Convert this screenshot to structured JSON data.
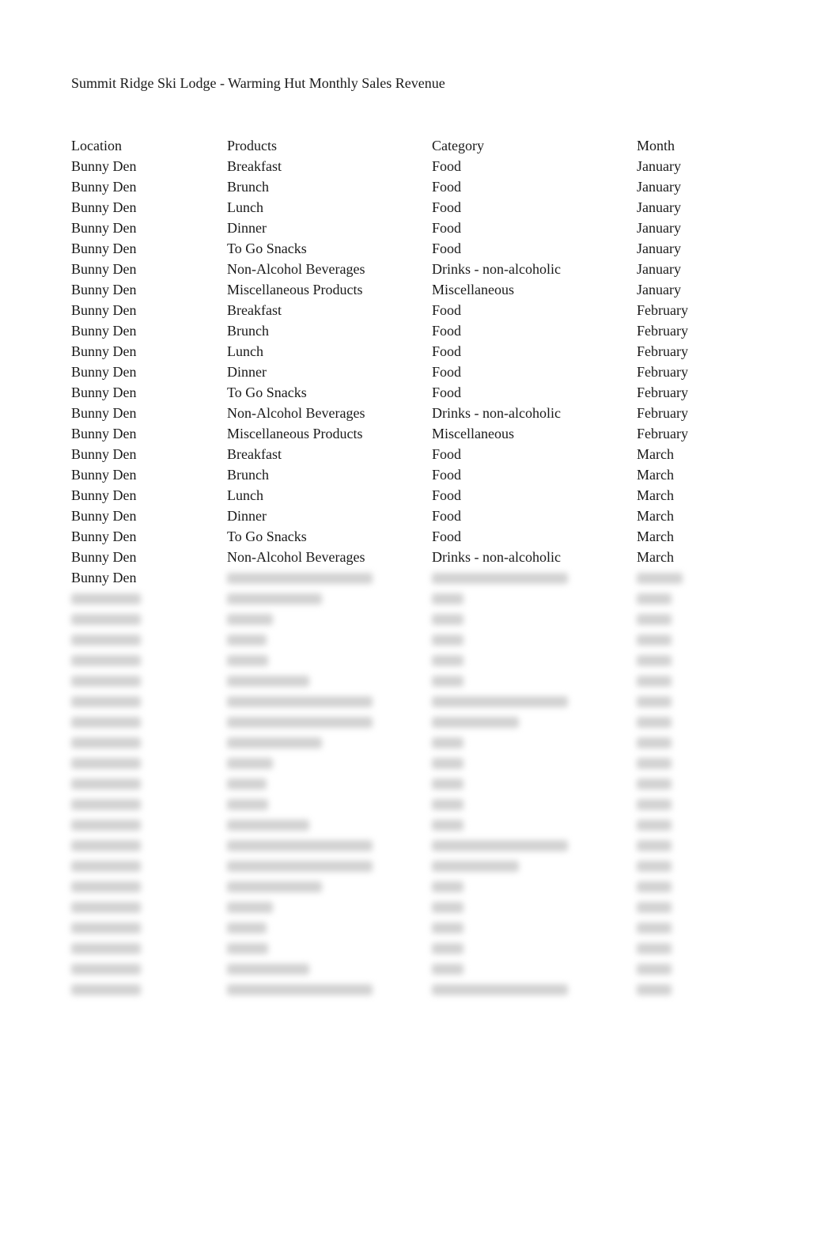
{
  "document": {
    "title": "Summit Ridge Ski Lodge - Warming Hut Monthly Sales Revenue"
  },
  "table": {
    "headers": [
      "Location",
      "Products",
      "Category",
      "Month"
    ],
    "rows": [
      [
        "Bunny Den",
        "Breakfast",
        "Food",
        "January"
      ],
      [
        "Bunny Den",
        "Brunch",
        "Food",
        "January"
      ],
      [
        "Bunny Den",
        "Lunch",
        "Food",
        "January"
      ],
      [
        "Bunny Den",
        "Dinner",
        "Food",
        "January"
      ],
      [
        "Bunny Den",
        "To Go Snacks",
        "Food",
        "January"
      ],
      [
        "Bunny Den",
        "Non-Alcohol Beverages",
        "Drinks - non-alcoholic",
        "January"
      ],
      [
        "Bunny Den",
        "Miscellaneous Products",
        "Miscellaneous",
        "January"
      ],
      [
        "Bunny Den",
        "Breakfast",
        "Food",
        "February"
      ],
      [
        "Bunny Den",
        "Brunch",
        "Food",
        "February"
      ],
      [
        "Bunny Den",
        "Lunch",
        "Food",
        "February"
      ],
      [
        "Bunny Den",
        "Dinner",
        "Food",
        "February"
      ],
      [
        "Bunny Den",
        "To Go Snacks",
        "Food",
        "February"
      ],
      [
        "Bunny Den",
        "Non-Alcohol Beverages",
        "Drinks - non-alcoholic",
        "February"
      ],
      [
        "Bunny Den",
        "Miscellaneous Products",
        "Miscellaneous",
        "February"
      ],
      [
        "Bunny Den",
        "Breakfast",
        "Food",
        "March"
      ],
      [
        "Bunny Den",
        "Brunch",
        "Food",
        "March"
      ],
      [
        "Bunny Den",
        "Lunch",
        "Food",
        "March"
      ],
      [
        "Bunny Den",
        "Dinner",
        "Food",
        "March"
      ],
      [
        "Bunny Den",
        "To Go Snacks",
        "Food",
        "March"
      ],
      [
        "Bunny Den",
        "Non-Alcohol Beverages",
        "Drinks - non-alcoholic",
        "March"
      ],
      [
        "Bunny Den",
        null,
        null,
        null
      ]
    ],
    "obscured_row_count": 20
  }
}
